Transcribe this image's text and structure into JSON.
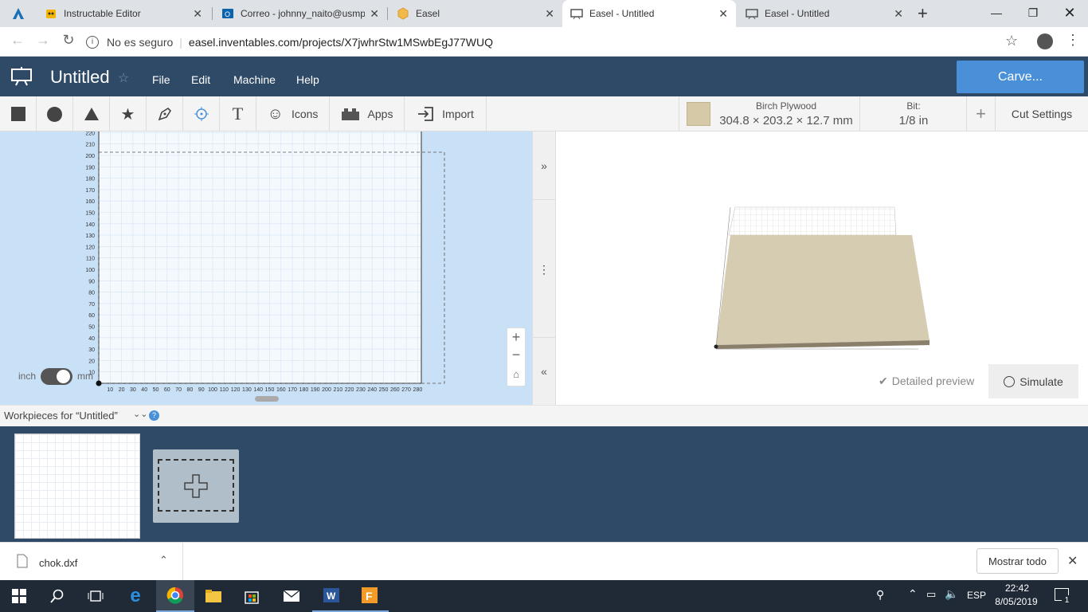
{
  "browser": {
    "tabs": [
      {
        "title": "Instructable Editor",
        "active": false
      },
      {
        "title": "Correo - johnny_naito@usmp",
        "active": false
      },
      {
        "title": "Easel",
        "active": false
      },
      {
        "title": "Easel - Untitled",
        "active": true
      },
      {
        "title": "Easel - Untitled",
        "active": false
      }
    ],
    "new_tab": "+",
    "security_label": "No es seguro",
    "url": "easel.inventables.com/projects/X7jwhrStw1MSwbEgJ77WUQ"
  },
  "app": {
    "title": "Untitled",
    "menu": [
      "File",
      "Edit",
      "Machine",
      "Help"
    ],
    "carve_label": "Carve...",
    "brand_color": "#2e4a66",
    "accent_color": "#4a90d9"
  },
  "toolbar": {
    "shapes": [
      "square-tool-icon",
      "circle-tool-icon",
      "triangle-tool-icon",
      "star-tool-icon",
      "pen-tool-icon",
      "point-tool-icon",
      "text-tool-icon"
    ],
    "icons_label": "Icons",
    "apps_label": "Apps",
    "import_label": "Import",
    "material_name": "Birch Plywood",
    "material_dims": "304.8 × 203.2 × 12.7 mm",
    "bit_label": "Bit:",
    "bit_value": "1/8 in",
    "cut_settings_label": "Cut Settings"
  },
  "canvas": {
    "y_ticks": [
      "220",
      "210",
      "200",
      "190",
      "180",
      "170",
      "160",
      "150",
      "140",
      "130",
      "120",
      "110",
      "100",
      "90",
      "80",
      "70",
      "60",
      "50",
      "40",
      "30",
      "20",
      "10"
    ],
    "x_ticks": [
      "10",
      "20",
      "30",
      "40",
      "50",
      "60",
      "70",
      "80",
      "90",
      "100",
      "110",
      "120",
      "130",
      "140",
      "150",
      "160",
      "170",
      "180",
      "190",
      "200",
      "210",
      "220",
      "230",
      "240",
      "250",
      "260",
      "270",
      "280"
    ],
    "unit_left": "inch",
    "unit_right": "mm"
  },
  "preview": {
    "detailed_label": "Detailed preview",
    "simulate_label": "Simulate"
  },
  "workpieces": {
    "label": "Workpieces for “Untitled”"
  },
  "download": {
    "filename": "chok.dxf",
    "show_all": "Mostrar todo"
  },
  "taskbar": {
    "lang": "ESP",
    "time": "22:42",
    "date": "8/05/2019",
    "notif_count": "1"
  }
}
